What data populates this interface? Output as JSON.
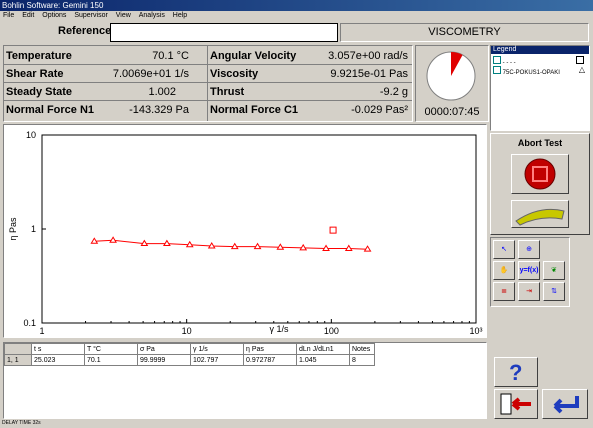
{
  "window": {
    "title": "Bohlin Software: Gemini 150"
  },
  "menu": [
    "File",
    "Edit",
    "Options",
    "Supervisor",
    "View",
    "Analysis",
    "Help"
  ],
  "reference": {
    "label": "Reference",
    "value": ""
  },
  "mode_label": "VISCOMETRY",
  "readouts": [
    {
      "label": "Temperature",
      "value": "70.1 °C"
    },
    {
      "label": "Angular Velocity",
      "value": "3.057e+00 rad/s"
    },
    {
      "label": "Shear Rate",
      "value": "7.0069e+01 1/s"
    },
    {
      "label": "Viscosity",
      "value": "9.9215e-01 Pas"
    },
    {
      "label": "Steady State",
      "value": "1.002"
    },
    {
      "label": "Thrust",
      "value": "-9.2 g"
    },
    {
      "label": "Normal Force N1",
      "value": "-143.329 Pa"
    },
    {
      "label": "Normal Force C1",
      "value": "-0.029 Pas²"
    }
  ],
  "timer": "0000:07:45",
  "timer_progress": 0.08,
  "legend": {
    "title": "Legend",
    "entries": [
      "- - - -",
      "75C-POKUS1-OPAKI"
    ]
  },
  "abort": {
    "label": "Abort Test"
  },
  "chart_data": {
    "type": "line",
    "xlabel": "γ 1/s",
    "ylabel": "η Pas",
    "xscale": "log",
    "yscale": "log",
    "xlim": [
      1,
      1000
    ],
    "ylim": [
      0.1,
      10
    ],
    "x_ticks": [
      "1",
      "10",
      "100",
      "10³"
    ],
    "y_ticks": [
      "10",
      "1",
      "0.1"
    ],
    "series": [
      {
        "name": "75C-POKUS1-OPAKI",
        "marker": "triangle",
        "color": "#ff0000",
        "x": [
          2.3,
          3.1,
          5.1,
          7.3,
          10.5,
          14.9,
          21.5,
          30.9,
          44.4,
          63.9,
          91.9,
          132,
          178
        ],
        "y": [
          0.74,
          0.76,
          0.7,
          0.7,
          0.68,
          0.66,
          0.65,
          0.65,
          0.64,
          0.63,
          0.62,
          0.62,
          0.61
        ]
      }
    ],
    "extra_points": [
      {
        "x": 102.8,
        "y": 0.9728,
        "marker": "square",
        "color": "#ff0000"
      }
    ],
    "grid": false
  },
  "table": {
    "headers": [
      "t s",
      "T °C",
      "σ Pa",
      "γ 1/s",
      "η Pas",
      "dLn J/dLn1",
      "Notes"
    ],
    "rows": [
      [
        "1, 1",
        "25.023",
        "70.1",
        "99.9999",
        "102.797",
        "0.972787",
        "1.045",
        "8"
      ]
    ]
  },
  "tools": {
    "yfx": "y=f(x)"
  },
  "status": "DELAY TIME 32s",
  "colors": {
    "accent": "#ff0000",
    "title": "#0a246a",
    "plot_bg": "#ffffff"
  }
}
